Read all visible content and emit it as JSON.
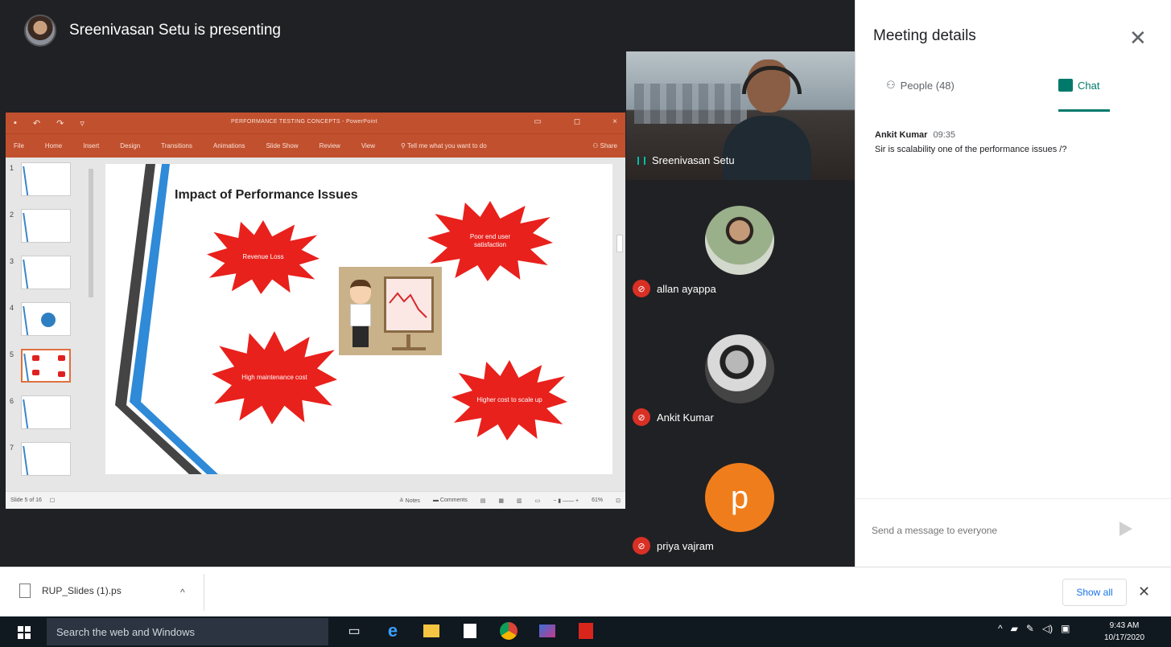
{
  "meet": {
    "presenter_text": "Sreenivasan Setu is presenting",
    "participants": [
      {
        "name": "Sreenivasan Setu"
      },
      {
        "name": "allan ayappa"
      },
      {
        "name": "Ankit Kumar"
      },
      {
        "name": "priya vajram",
        "initial": "p"
      }
    ]
  },
  "ppt": {
    "window_title": "PERFORMANCE TESTING CONCEPTS - PowerPoint",
    "ribbon_tabs": [
      "File",
      "Home",
      "Insert",
      "Design",
      "Transitions",
      "Animations",
      "Slide Show",
      "Review",
      "View"
    ],
    "tell_me": "Tell me what you want to do",
    "share": "Share",
    "thumb_numbers": [
      "1",
      "2",
      "3",
      "4",
      "5",
      "6",
      "7"
    ],
    "active_slide": 5,
    "slide": {
      "title": "Impact of Performance Issues",
      "bursts": [
        "Revenue Loss",
        "Poor end user satisfaction",
        "High maintenance cost",
        "Higher cost to scale up"
      ]
    },
    "status": {
      "slide_of": "Slide 5 of 16",
      "notes": "Notes",
      "comments": "Comments",
      "zoom": "61%"
    }
  },
  "panel": {
    "title": "Meeting details",
    "people_tab": "People (48)",
    "chat_tab": "Chat",
    "messages": [
      {
        "sender": "Ankit Kumar",
        "time": "09:35",
        "text": "Sir is scalability one of the performance issues /?"
      }
    ],
    "input_placeholder": "Send a message to everyone"
  },
  "downloads": {
    "file_name": "RUP_Slides (1).ps",
    "show_all": "Show all"
  },
  "taskbar": {
    "search_placeholder": "Search the web and Windows",
    "time": "9:43 AM",
    "date": "10/17/2020"
  },
  "colors": {
    "meet_bg": "#202124",
    "ppt_accent": "#c1502e",
    "burst_red": "#e8211c",
    "chat_accent": "#00796b",
    "muted_red": "#d93025",
    "avatar_orange": "#f07d1c"
  }
}
